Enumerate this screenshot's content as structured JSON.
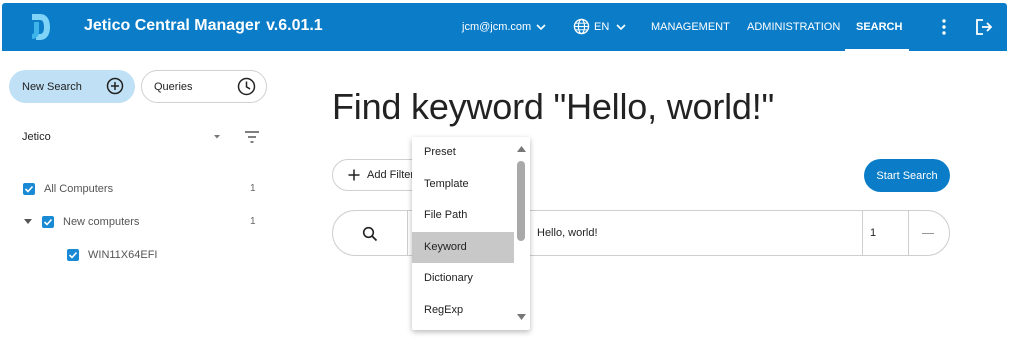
{
  "header": {
    "app_name": "Jetico Central Manager",
    "version": "v.6.01.1",
    "user": "jcm@jcm.com",
    "language": "EN",
    "nav": [
      {
        "label": "MANAGEMENT"
      },
      {
        "label": "ADMINISTRATION"
      },
      {
        "label": "SEARCH",
        "active": true
      }
    ],
    "brand_color": "#0b7dc8",
    "icons": [
      "jetico-logo-icon",
      "chevron-down-icon",
      "globe-icon",
      "more-vert-icon",
      "logout-icon"
    ]
  },
  "sidebar": {
    "new_search_label": "New Search",
    "queries_label": "Queries",
    "organization": "Jetico",
    "tree": [
      {
        "label": "All Computers",
        "count": "1",
        "checked": true
      },
      {
        "label": "New computers",
        "count": "1",
        "checked": true,
        "expanded": true
      },
      {
        "label": "WIN11X64EFI",
        "checked": true
      }
    ],
    "accent_color": "#1a8ad4"
  },
  "main": {
    "title": "Find keyword \"Hello, world!\"",
    "add_filter_label": "Add Filter",
    "start_search_label": "Start Search",
    "filter_row": {
      "value": "Hello, world!",
      "count": "1"
    }
  },
  "dropdown": {
    "options": [
      {
        "label": "Preset"
      },
      {
        "label": "Template"
      },
      {
        "label": "File Path"
      },
      {
        "label": "Keyword",
        "selected": true
      },
      {
        "label": "Dictionary"
      },
      {
        "label": "RegExp"
      }
    ]
  }
}
